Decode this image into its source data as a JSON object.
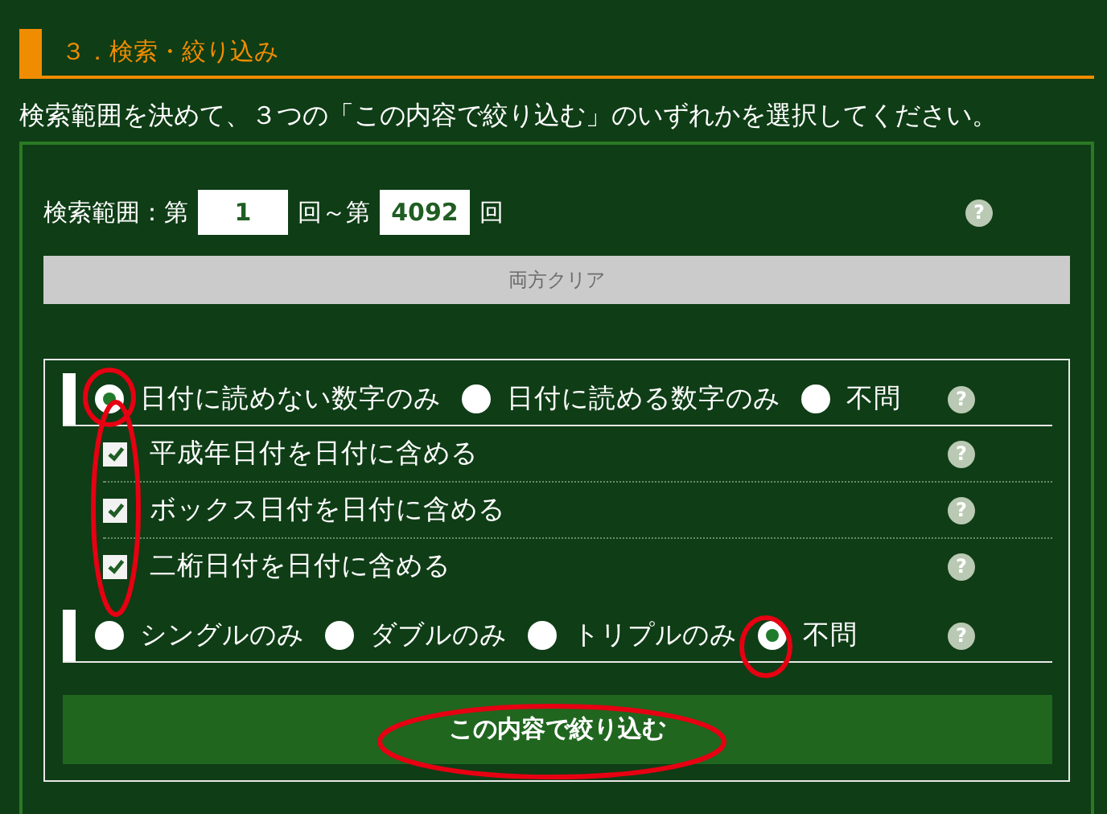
{
  "section": {
    "title": "３．検索・絞り込み"
  },
  "instruction": "検索範囲を決めて、３つの「この内容で絞り込む」のいずれかを選択してください。",
  "range": {
    "label": "検索範囲：第",
    "from": "1",
    "middle": "回～第",
    "to": "4092",
    "suffix": "回",
    "help": "?"
  },
  "clear_button": "両方クリア",
  "filters": [
    {
      "kind": "radio",
      "help": "?",
      "options": [
        {
          "label": "日付に読めない数字のみ",
          "selected": true
        },
        {
          "label": "日付に読める数字のみ",
          "selected": false
        },
        {
          "label": "不問",
          "selected": false
        }
      ]
    },
    {
      "kind": "checkbox",
      "label": "平成年日付を日付に含める",
      "checked": true,
      "help": "?"
    },
    {
      "kind": "checkbox",
      "label": "ボックス日付を日付に含める",
      "checked": true,
      "help": "?"
    },
    {
      "kind": "checkbox",
      "label": "二桁日付を日付に含める",
      "checked": true,
      "help": "?"
    },
    {
      "kind": "radio",
      "help": "?",
      "options": [
        {
          "label": "シングルのみ",
          "selected": false
        },
        {
          "label": "ダブルのみ",
          "selected": false
        },
        {
          "label": "トリプルのみ",
          "selected": false
        },
        {
          "label": "不問",
          "selected": true
        }
      ]
    }
  ],
  "submit_button": "この内容で絞り込む"
}
